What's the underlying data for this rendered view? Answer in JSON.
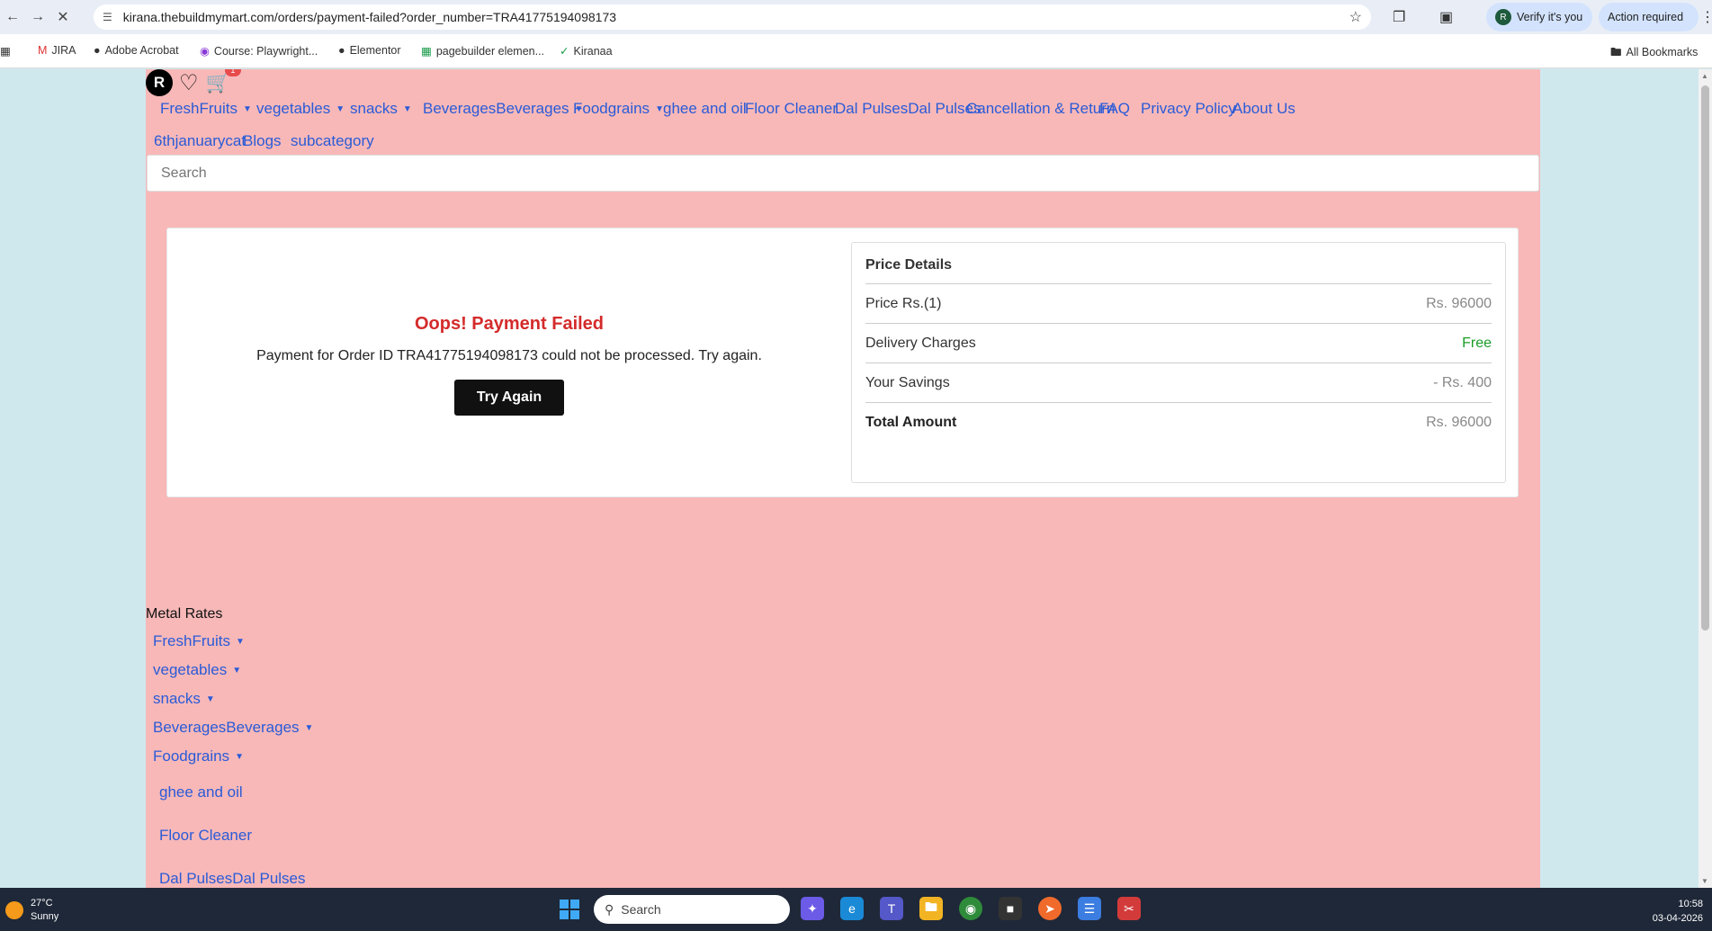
{
  "browser": {
    "url": "kirana.thebuildmymart.com/orders/payment-failed?order_number=TRA41775194098173",
    "verify_label": "Verify it's you",
    "verify_avatar": "R",
    "action_label": "Action required",
    "bookmarks": [
      "JIRA",
      "Adobe Acrobat",
      "Course: Playwright...",
      "Elementor",
      "pagebuilder elemen...",
      "Kiranaa"
    ],
    "all_bookmarks": "All Bookmarks"
  },
  "header": {
    "avatar_letter": "R",
    "cart_count": "1",
    "menu": [
      {
        "label": "FreshFruits",
        "dropdown": true
      },
      {
        "label": "vegetables",
        "dropdown": true
      },
      {
        "label": "snacks",
        "dropdown": true
      },
      {
        "label": "BeveragesBeverages",
        "dropdown": true
      },
      {
        "label": "Foodgrains",
        "dropdown": true
      },
      {
        "label": "ghee and oil",
        "dropdown": false
      },
      {
        "label": "Floor Cleaner",
        "dropdown": false
      },
      {
        "label": "Dal PulsesDal Pulses",
        "dropdown": false
      },
      {
        "label": "Cancellation & Return",
        "dropdown": false
      },
      {
        "label": "FAQ",
        "dropdown": false
      },
      {
        "label": "Privacy Policy",
        "dropdown": false
      },
      {
        "label": "About Us",
        "dropdown": false
      },
      {
        "label": "6thjanuarycat",
        "dropdown": false
      },
      {
        "label": "Blogs",
        "dropdown": false
      },
      {
        "label": "subcategory",
        "dropdown": false
      }
    ],
    "search_placeholder": "Search"
  },
  "payment": {
    "title": "Oops! Payment Failed",
    "message": "Payment for Order ID TRA41775194098173 could not be processed. Try again.",
    "button": "Try Again"
  },
  "price_details": {
    "heading": "Price Details",
    "rows": [
      {
        "label": "Price Rs.(1)",
        "value": "Rs. 96000"
      },
      {
        "label": "Delivery Charges",
        "value": "Free"
      },
      {
        "label": "Your Savings",
        "value": "- Rs. 400"
      },
      {
        "label": "Total Amount",
        "value": "Rs. 96000"
      }
    ]
  },
  "footer": {
    "heading": "Metal Rates",
    "links": [
      "FreshFruits",
      "vegetables",
      "snacks",
      "BeveragesBeverages",
      "Foodgrains",
      "ghee and oil",
      "Floor Cleaner",
      "Dal PulsesDal Pulses"
    ]
  },
  "taskbar": {
    "temperature": "27°C",
    "weather": "Sunny",
    "search_label": "Search",
    "time": "10:58",
    "date": "03-04-2026"
  },
  "colors": {
    "page_bg": "#f8b8b8",
    "link": "#2a5bd7",
    "error": "#d42b2b",
    "free": "#1a9c2a"
  }
}
